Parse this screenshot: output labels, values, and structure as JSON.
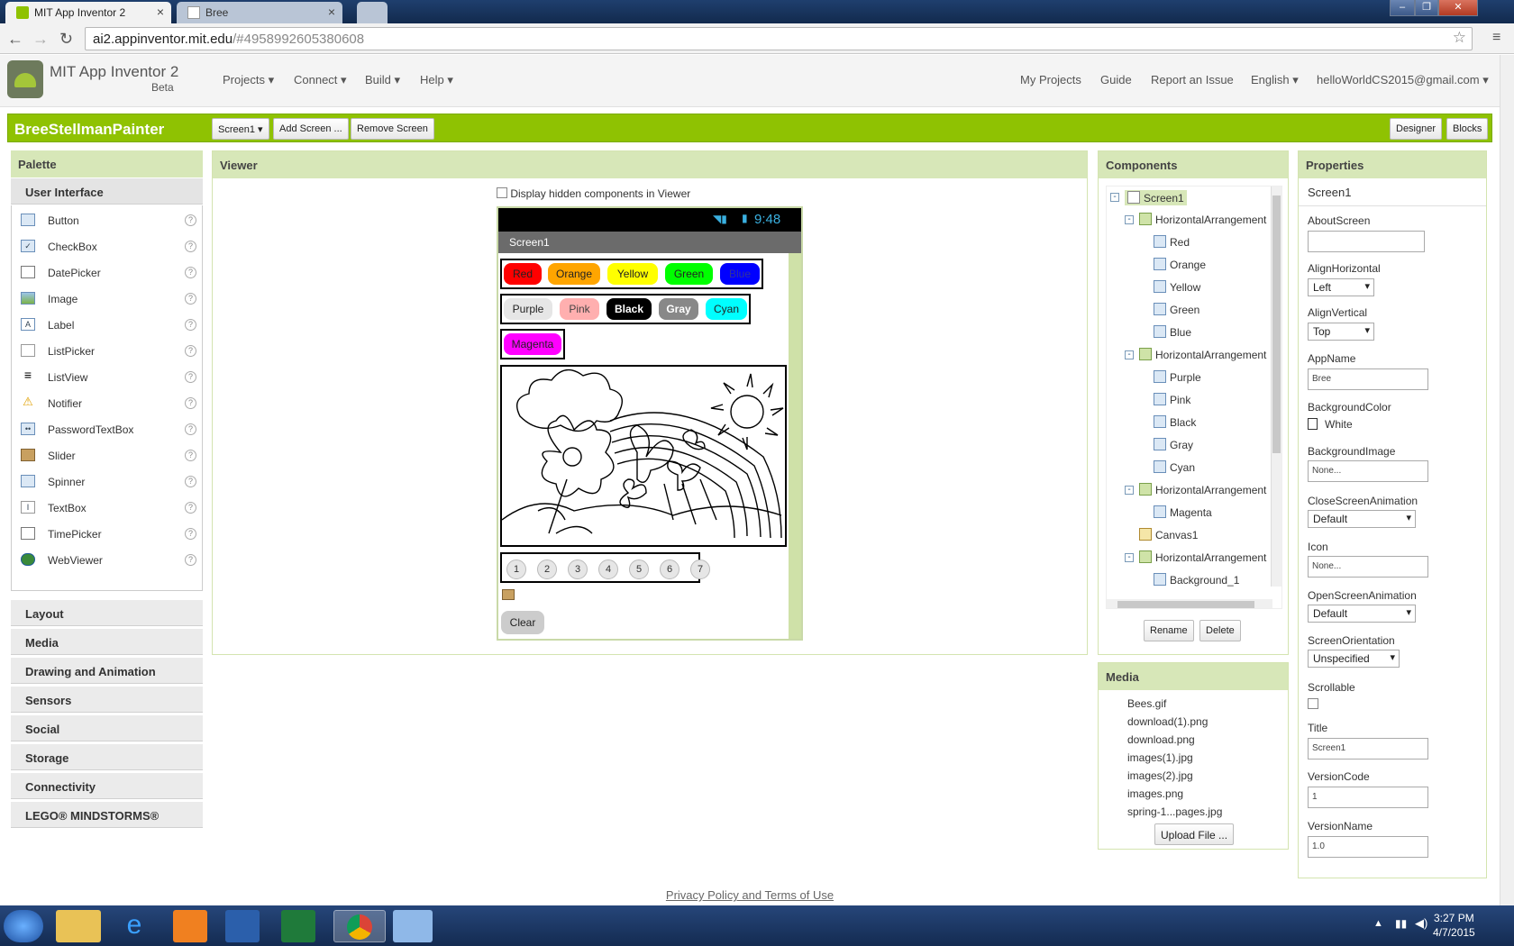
{
  "browser": {
    "tabs": [
      {
        "label": "MIT App Inventor 2",
        "active": true
      },
      {
        "label": "Bree",
        "active": false
      }
    ],
    "url_host": "ai2.appinventor.mit.edu",
    "url_path": "/#4958992605380608"
  },
  "header": {
    "app_title": "MIT App Inventor 2",
    "beta": "Beta",
    "menu_left": [
      "Projects ▾",
      "Connect ▾",
      "Build ▾",
      "Help ▾"
    ],
    "menu_right": [
      "My Projects",
      "Guide",
      "Report an Issue",
      "English ▾",
      "helloWorldCS2015@gmail.com ▾"
    ]
  },
  "project_bar": {
    "project_name": "BreeStellmanPainter",
    "screen_select": "Screen1 ▾",
    "add_screen": "Add Screen ...",
    "remove_screen": "Remove Screen",
    "designer": "Designer",
    "blocks": "Blocks"
  },
  "palette": {
    "title": "Palette",
    "open_category": "User Interface",
    "items": [
      {
        "label": "Button",
        "icon": "button-icon"
      },
      {
        "label": "CheckBox",
        "icon": "checkbox-icon"
      },
      {
        "label": "DatePicker",
        "icon": "datepicker-icon"
      },
      {
        "label": "Image",
        "icon": "image-icon"
      },
      {
        "label": "Label",
        "icon": "label-icon"
      },
      {
        "label": "ListPicker",
        "icon": "listpicker-icon"
      },
      {
        "label": "ListView",
        "icon": "listview-icon"
      },
      {
        "label": "Notifier",
        "icon": "notifier-icon"
      },
      {
        "label": "PasswordTextBox",
        "icon": "passwordtextbox-icon"
      },
      {
        "label": "Slider",
        "icon": "slider-icon"
      },
      {
        "label": "Spinner",
        "icon": "spinner-icon"
      },
      {
        "label": "TextBox",
        "icon": "textbox-icon"
      },
      {
        "label": "TimePicker",
        "icon": "timepicker-icon"
      },
      {
        "label": "WebViewer",
        "icon": "webviewer-icon"
      }
    ],
    "help_glyph": "?",
    "categories": [
      "Layout",
      "Media",
      "Drawing and Animation",
      "Sensors",
      "Social",
      "Storage",
      "Connectivity",
      "LEGO® MINDSTORMS®"
    ]
  },
  "viewer": {
    "title": "Viewer",
    "hidden_checkbox_label": "Display hidden components in Viewer",
    "hidden_checked": false,
    "phone_time": "9:48",
    "screen_title": "Screen1",
    "row1": [
      {
        "label": "Red",
        "bg": "#ff0000",
        "fg": "#222222"
      },
      {
        "label": "Orange",
        "bg": "#ffa500",
        "fg": "#222222"
      },
      {
        "label": "Yellow",
        "bg": "#ffff00",
        "fg": "#222222"
      },
      {
        "label": "Green",
        "bg": "#00ff00",
        "fg": "#222222"
      },
      {
        "label": "Blue",
        "bg": "#0000ff",
        "fg": "#333399"
      }
    ],
    "row2": [
      {
        "label": "Purple",
        "bg": "#e6e6e6",
        "fg": "#222222"
      },
      {
        "label": "Pink",
        "bg": "#ffafaf",
        "fg": "#444444"
      },
      {
        "label": "Black",
        "bg": "#000000",
        "fg": "#ffffff"
      },
      {
        "label": "Gray",
        "bg": "#888888",
        "fg": "#ffffff"
      },
      {
        "label": "Cyan",
        "bg": "#00ffff",
        "fg": "#222222"
      }
    ],
    "row3": [
      {
        "label": "Magenta",
        "bg": "#ff00ff",
        "fg": "#222222"
      }
    ],
    "numbers": [
      "1",
      "2",
      "3",
      "4",
      "5",
      "6",
      "7"
    ],
    "clear": "Clear"
  },
  "components": {
    "title": "Components",
    "tree": [
      {
        "label": "Screen1",
        "level": 0,
        "toggle": "⊟",
        "selected": true,
        "icon": "screen-icon"
      },
      {
        "label": "HorizontalArrangement",
        "level": 1,
        "toggle": "⊟",
        "icon": "arrangement-icon"
      },
      {
        "label": "Red",
        "level": 2,
        "icon": "button-icon"
      },
      {
        "label": "Orange",
        "level": 2,
        "icon": "button-icon"
      },
      {
        "label": "Yellow",
        "level": 2,
        "icon": "button-icon"
      },
      {
        "label": "Green",
        "level": 2,
        "icon": "button-icon"
      },
      {
        "label": "Blue",
        "level": 2,
        "icon": "button-icon"
      },
      {
        "label": "HorizontalArrangement",
        "level": 1,
        "toggle": "⊟",
        "icon": "arrangement-icon"
      },
      {
        "label": "Purple",
        "level": 2,
        "icon": "button-icon"
      },
      {
        "label": "Pink",
        "level": 2,
        "icon": "button-icon"
      },
      {
        "label": "Black",
        "level": 2,
        "icon": "button-icon"
      },
      {
        "label": "Gray",
        "level": 2,
        "icon": "button-icon"
      },
      {
        "label": "Cyan",
        "level": 2,
        "icon": "button-icon"
      },
      {
        "label": "HorizontalArrangement",
        "level": 1,
        "toggle": "⊟",
        "icon": "arrangement-icon"
      },
      {
        "label": "Magenta",
        "level": 2,
        "icon": "button-icon"
      },
      {
        "label": "Canvas1",
        "level": 1,
        "icon": "canvas-icon"
      },
      {
        "label": "HorizontalArrangement",
        "level": 1,
        "toggle": "⊟",
        "icon": "arrangement-icon"
      },
      {
        "label": "Background_1",
        "level": 2,
        "icon": "button-icon"
      }
    ],
    "rename": "Rename",
    "delete": "Delete"
  },
  "media": {
    "title": "Media",
    "files": [
      "Bees.gif",
      "download(1).png",
      "download.png",
      "images(1).jpg",
      "images(2).jpg",
      "images.png",
      "spring-1...pages.jpg"
    ],
    "upload": "Upload File ..."
  },
  "properties": {
    "title": "Properties",
    "component": "Screen1",
    "about_label": "AboutScreen",
    "about_value": "",
    "align_h_label": "AlignHorizontal",
    "align_h_value": "Left",
    "align_v_label": "AlignVertical",
    "align_v_value": "Top",
    "appname_label": "AppName",
    "appname_value": "Bree",
    "bgcolor_label": "BackgroundColor",
    "bgcolor_value": "White",
    "bgimage_label": "BackgroundImage",
    "bgimage_value": "None...",
    "close_anim_label": "CloseScreenAnimation",
    "close_anim_value": "Default",
    "icon_label": "Icon",
    "icon_value": "None...",
    "open_anim_label": "OpenScreenAnimation",
    "open_anim_value": "Default",
    "orientation_label": "ScreenOrientation",
    "orientation_value": "Unspecified",
    "scrollable_label": "Scrollable",
    "scrollable_checked": false,
    "title_label": "Title",
    "title_value": "Screen1",
    "version_code_label": "VersionCode",
    "version_code_value": "1",
    "version_name_label": "VersionName",
    "version_name_value": "1.0"
  },
  "footer": {
    "link": "Privacy Policy and Terms of Use"
  },
  "taskbar": {
    "time": "3:27 PM",
    "date": "4/7/2015",
    "apps": [
      "start-icon",
      "explorer-icon",
      "ie-icon",
      "media-player-icon",
      "word-icon",
      "excel-icon",
      "chrome-icon",
      "notepad-icon"
    ]
  },
  "colors": {
    "accent_green": "#8fc202",
    "panel_header": "#d7e7b8"
  }
}
